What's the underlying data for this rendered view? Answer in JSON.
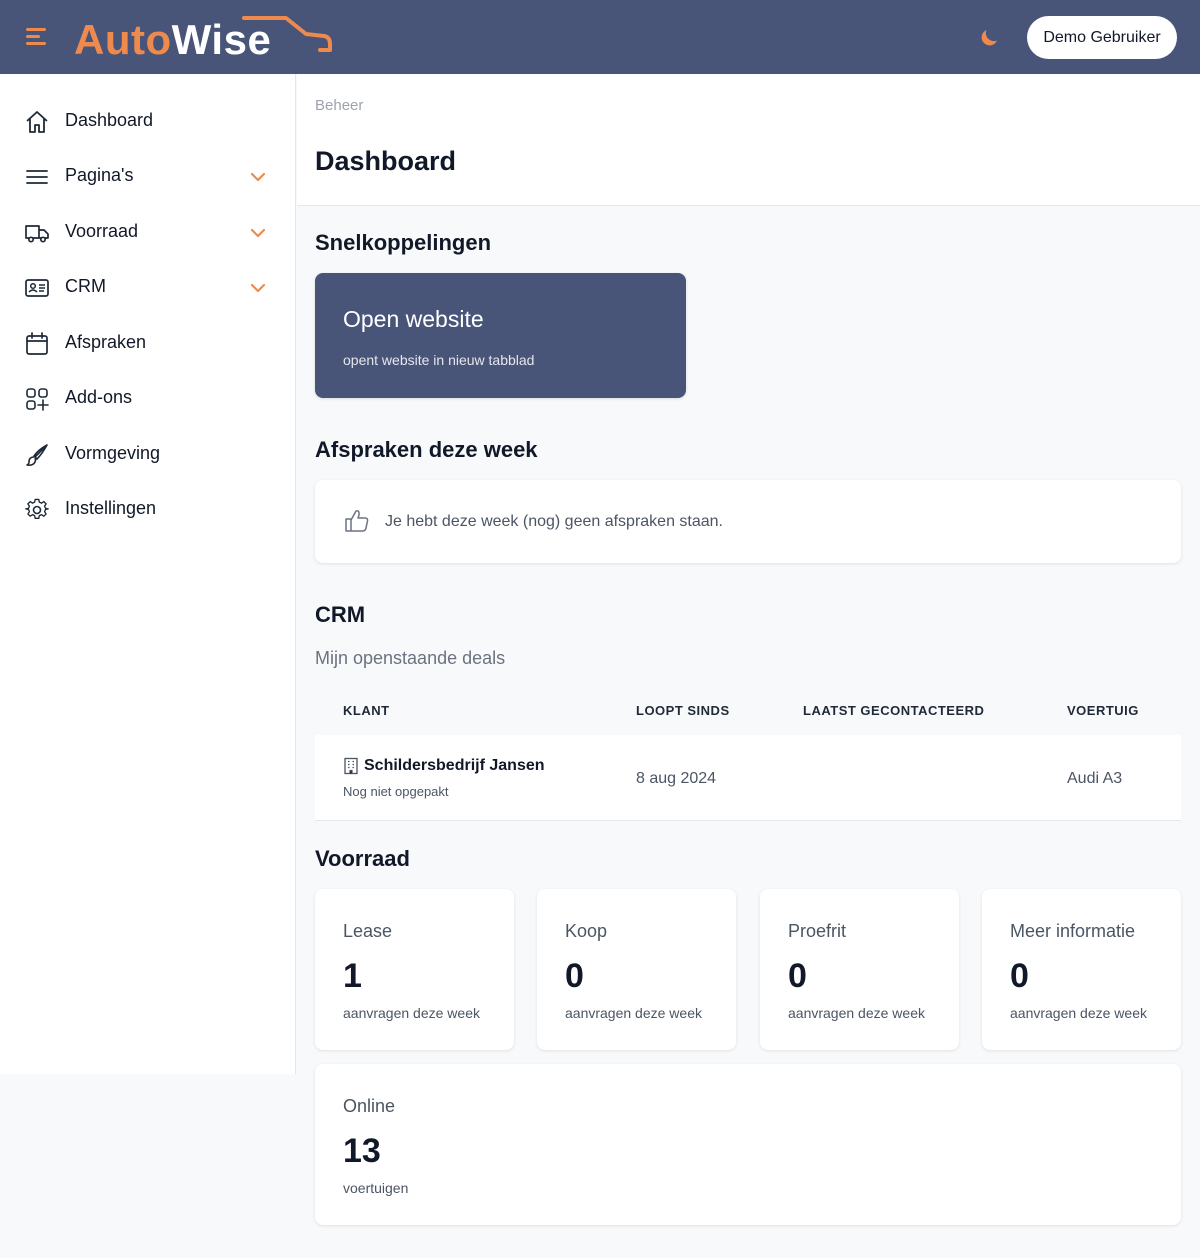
{
  "header": {
    "logo_part1": "Auto",
    "logo_part2": "Wise",
    "user_button": "Demo Gebruiker"
  },
  "sidebar": {
    "items": [
      {
        "label": "Dashboard",
        "icon": "home-icon",
        "expandable": false
      },
      {
        "label": "Pagina's",
        "icon": "menu-lines-icon",
        "expandable": true
      },
      {
        "label": "Voorraad",
        "icon": "truck-icon",
        "expandable": true
      },
      {
        "label": "CRM",
        "icon": "contact-card-icon",
        "expandable": true
      },
      {
        "label": "Afspraken",
        "icon": "calendar-icon",
        "expandable": false
      },
      {
        "label": "Add-ons",
        "icon": "add-ons-icon",
        "expandable": false
      },
      {
        "label": "Vormgeving",
        "icon": "brush-icon",
        "expandable": false
      },
      {
        "label": "Instellingen",
        "icon": "gear-icon",
        "expandable": false
      }
    ]
  },
  "page": {
    "breadcrumb": "Beheer",
    "title": "Dashboard"
  },
  "quicklinks": {
    "heading": "Snelkoppelingen",
    "card_title": "Open website",
    "card_subtitle": "opent website in nieuw tabblad"
  },
  "appointments": {
    "heading": "Afspraken deze week",
    "empty_text": "Je hebt deze week (nog) geen afspraken staan."
  },
  "crm": {
    "heading": "CRM",
    "subheading": "Mijn openstaande deals",
    "columns": [
      "KLANT",
      "LOOPT SINDS",
      "LAATST GECONTACTEERD",
      "VOERTUIG"
    ],
    "rows": [
      {
        "client": "Schildersbedrijf Jansen",
        "status": "Nog niet opgepakt",
        "since": "8 aug 2024",
        "last_contacted": "",
        "vehicle": "Audi A3"
      }
    ]
  },
  "stock": {
    "heading": "Voorraad",
    "cards": [
      {
        "label": "Lease",
        "value": "1",
        "sub": "aanvragen deze week"
      },
      {
        "label": "Koop",
        "value": "0",
        "sub": "aanvragen deze week"
      },
      {
        "label": "Proefrit",
        "value": "0",
        "sub": "aanvragen deze week"
      },
      {
        "label": "Meer informatie",
        "value": "0",
        "sub": "aanvragen deze week"
      }
    ],
    "online": {
      "label": "Online",
      "value": "13",
      "sub": "voertuigen"
    }
  },
  "colors": {
    "header_bg": "#485579",
    "accent": "#ef8a4f",
    "card_bg": "#ffffff",
    "page_bg": "#f8f9fb"
  }
}
